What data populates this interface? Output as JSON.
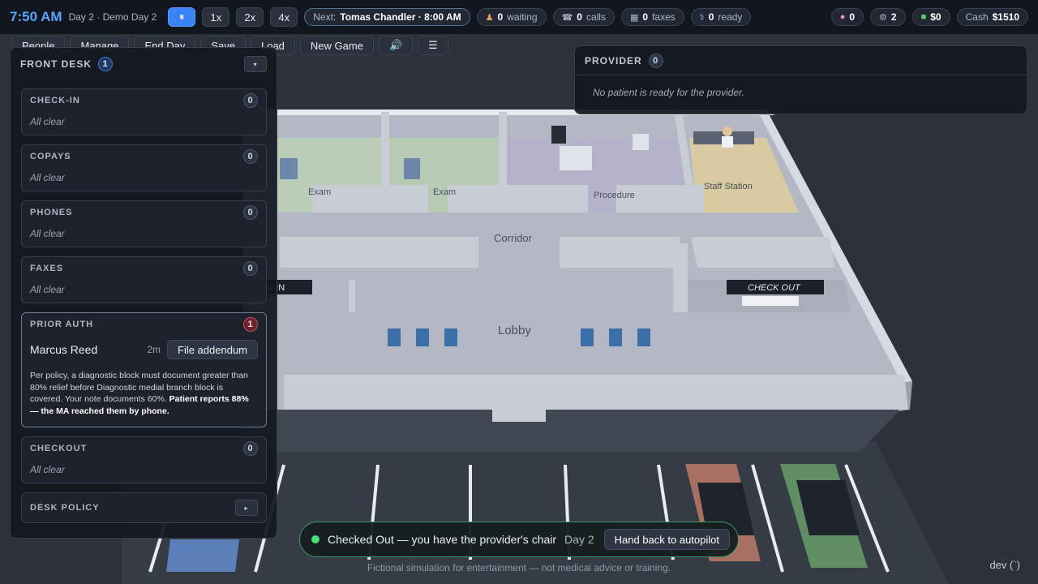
{
  "topbar": {
    "clock": "7:50 AM",
    "day": "Day 2 · Demo Day 2",
    "pause_symbol": "⏸",
    "speeds": [
      "1x",
      "2x",
      "4x"
    ],
    "next_prefix": "Next:",
    "next_value": "Tomas Chandler · 8:00 AM",
    "waiting": {
      "count": "0",
      "label": "waiting"
    },
    "calls": {
      "count": "0",
      "label": "calls"
    },
    "faxes": {
      "count": "0",
      "label": "faxes"
    },
    "ready": {
      "count": "0",
      "label": "ready"
    },
    "brain": "0",
    "gears": "2",
    "money": "$0",
    "cash_label": "Cash",
    "cash_value": "$1510"
  },
  "toolbar": {
    "people": "People",
    "manage": "Manage",
    "end_day": "End Day",
    "save": "Save",
    "load": "Load",
    "new_game": "New Game",
    "menu": "☰"
  },
  "desk": {
    "title": "FRONT DESK",
    "count": "1",
    "collapse_symbol": "▾",
    "empty_text": "All clear",
    "sections": [
      {
        "title": "CHECK-IN",
        "count": "0"
      },
      {
        "title": "COPAYS",
        "count": "0"
      },
      {
        "title": "PHONES",
        "count": "0"
      },
      {
        "title": "FAXES",
        "count": "0"
      }
    ],
    "prior_auth": {
      "title": "PRIOR AUTH",
      "count": "1",
      "patient": "Marcus Reed",
      "time": "2m",
      "action": "File addendum",
      "note_plain": "Per policy, a diagnostic block must document greater than 80% relief before Diagnostic medial branch block is covered. Your note documents 60%. ",
      "note_bold": "Patient reports 88% — the MA reached them by phone."
    },
    "checkout": {
      "title": "CHECKOUT",
      "count": "0"
    },
    "policy": {
      "title": "DESK POLICY",
      "expand_symbol": "▸"
    }
  },
  "provider": {
    "title": "PROVIDER",
    "count": "0",
    "empty": "No patient is ready for the provider."
  },
  "scene": {
    "rooms": {
      "exam_a": "Exam",
      "exam_b": "Exam",
      "procedure": "Procedure",
      "staff": "Staff Station",
      "corridor": "Corridor",
      "lobby": "Lobby",
      "checkin": "CHECK-IN",
      "checkout": "CHECK OUT"
    }
  },
  "toast": {
    "text": "Checked Out — you have the provider's chair",
    "day": "Day 2",
    "action": "Hand back to autopilot"
  },
  "footer": {
    "disclaimer": "Fictional simulation for entertainment — not medical advice or training.",
    "dev": "dev (`)"
  }
}
